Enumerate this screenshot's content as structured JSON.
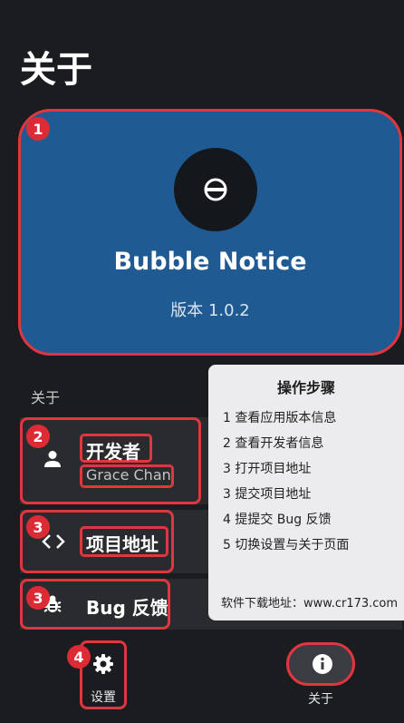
{
  "page": {
    "title": "关于"
  },
  "hero": {
    "app_name": "Bubble Notice",
    "version": "版本 1.0.2",
    "card_color": "#1f5a92"
  },
  "section": {
    "label": "关于"
  },
  "rows": [
    {
      "title": "开发者",
      "subtitle": "Grace Chan",
      "icon": "person-icon"
    },
    {
      "title": "项目地址",
      "icon": "code-icon"
    },
    {
      "title": "Bug 反馈",
      "icon": "bug-icon"
    }
  ],
  "steps_panel": {
    "title": "操作步骤",
    "steps": [
      "1 查看应用版本信息",
      "2 查看开发者信息",
      "3 打开项目地址",
      "3 提交项目地址",
      "4 提提交 Bug 反馈",
      "5 切换设置与关于页面"
    ],
    "footer": "软件下载地址：www.cr173.com"
  },
  "badges": [
    "1",
    "2",
    "3",
    "3",
    "4"
  ],
  "bottom_nav": [
    {
      "label": "设置",
      "icon": "gear-icon"
    },
    {
      "label": "关于",
      "icon": "info-icon",
      "active": true
    }
  ],
  "colors": {
    "highlight": "#e0363f",
    "badge": "#dc2b34",
    "background": "#1b1c1f"
  }
}
